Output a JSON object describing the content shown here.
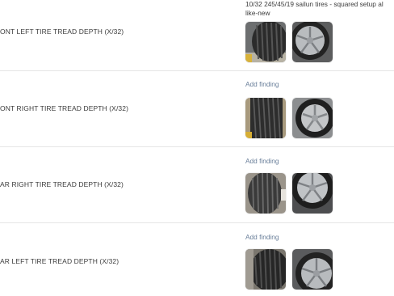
{
  "inspection": {
    "rows": [
      {
        "label": "ONT LEFT TIRE TREAD DEPTH (x/32)",
        "note_line1": "10/32 245/45/19 sailun tires - squared setup al",
        "note_line2": "like-new",
        "add_finding": "",
        "photos": [
          "tread-photo-icon",
          "wheel-photo-icon"
        ]
      },
      {
        "label": "ONT RIGHT TIRE TREAD DEPTH (x/32)",
        "add_finding": "Add finding",
        "photos": [
          "tread-photo-icon",
          "wheel-photo-icon"
        ]
      },
      {
        "label": "AR RIGHT TIRE TREAD DEPTH (x/32)",
        "add_finding": "Add finding",
        "photos": [
          "tread-photo-icon",
          "wheel-photo-icon"
        ]
      },
      {
        "label": "AR LEFT TIRE TREAD DEPTH (x/32)",
        "add_finding": "Add finding",
        "photos": [
          "tread-photo-icon",
          "wheel-photo-icon"
        ]
      }
    ]
  },
  "colors": {
    "label_text": "#3c3c3c",
    "link_text": "#6a7f9a",
    "divider": "#e6e6e6"
  }
}
